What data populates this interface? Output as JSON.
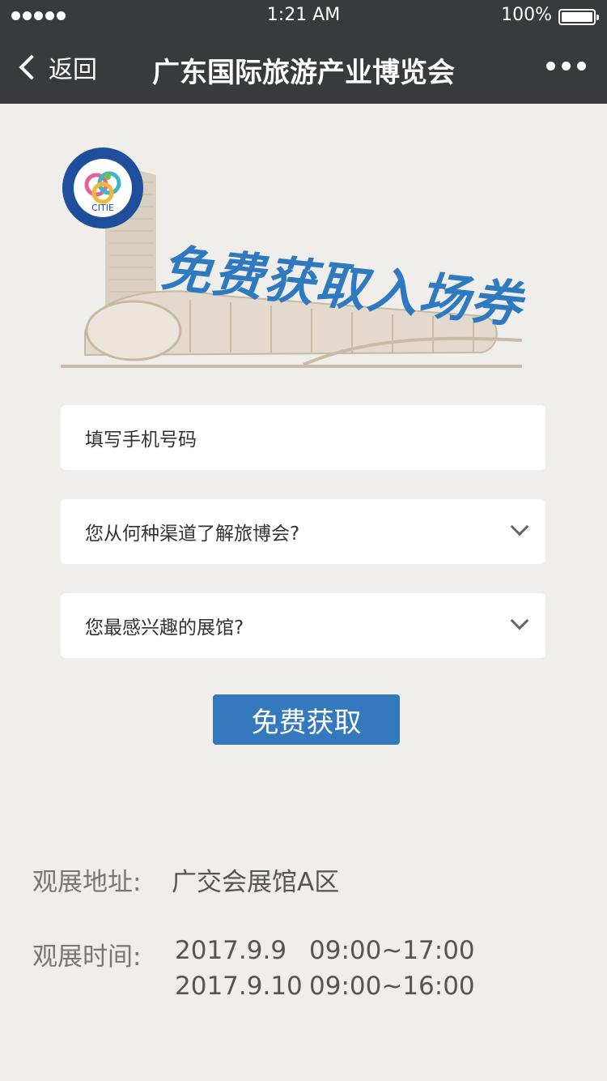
{
  "status_bar": {
    "time": "1:21 AM",
    "battery": "100%"
  },
  "nav": {
    "back_label": "返回",
    "title": "广东国际旅游产业博览会"
  },
  "hero": {
    "title": "免费获取入场券",
    "logo_text": "CITIE"
  },
  "form": {
    "phone_placeholder": "填写手机号码",
    "channel_placeholder": "您从何种渠道了解旅博会?",
    "hall_placeholder": "您最感兴趣的展馆?",
    "submit_label": "免费获取"
  },
  "info": {
    "address_label": "观展地址:",
    "address_value": "广交会展馆A区",
    "time_label": "观展时间:",
    "schedule": [
      {
        "date": "2017.9.9",
        "hours": "09:00~17:00"
      },
      {
        "date": "2017.9.10",
        "hours": "09:00~16:00"
      }
    ]
  },
  "colors": {
    "accent": "#3479bd",
    "topbar": "#393a3e",
    "background": "#f0eeea"
  }
}
